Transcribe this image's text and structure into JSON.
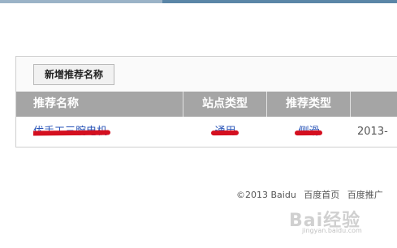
{
  "toolbar": {
    "add_label": "新增推荐名称"
  },
  "table": {
    "headers": [
      "推荐名称",
      "站点类型",
      "推荐类型",
      ""
    ],
    "rows": [
      {
        "name": "优手工三腕电机",
        "site_type": "通用",
        "rec_type": "侧滑",
        "date": "2013-"
      }
    ]
  },
  "footer": {
    "copyright": "©2013 Baidu",
    "link_home": "百度首页",
    "link_promo": "百度推广"
  },
  "watermark": {
    "brand": "Bai经验",
    "url": "jingyan.baidu.com"
  },
  "colors": {
    "header_bg": "#a5a5a5",
    "link": "#2a55b8",
    "redaction": "#d40f1f"
  }
}
